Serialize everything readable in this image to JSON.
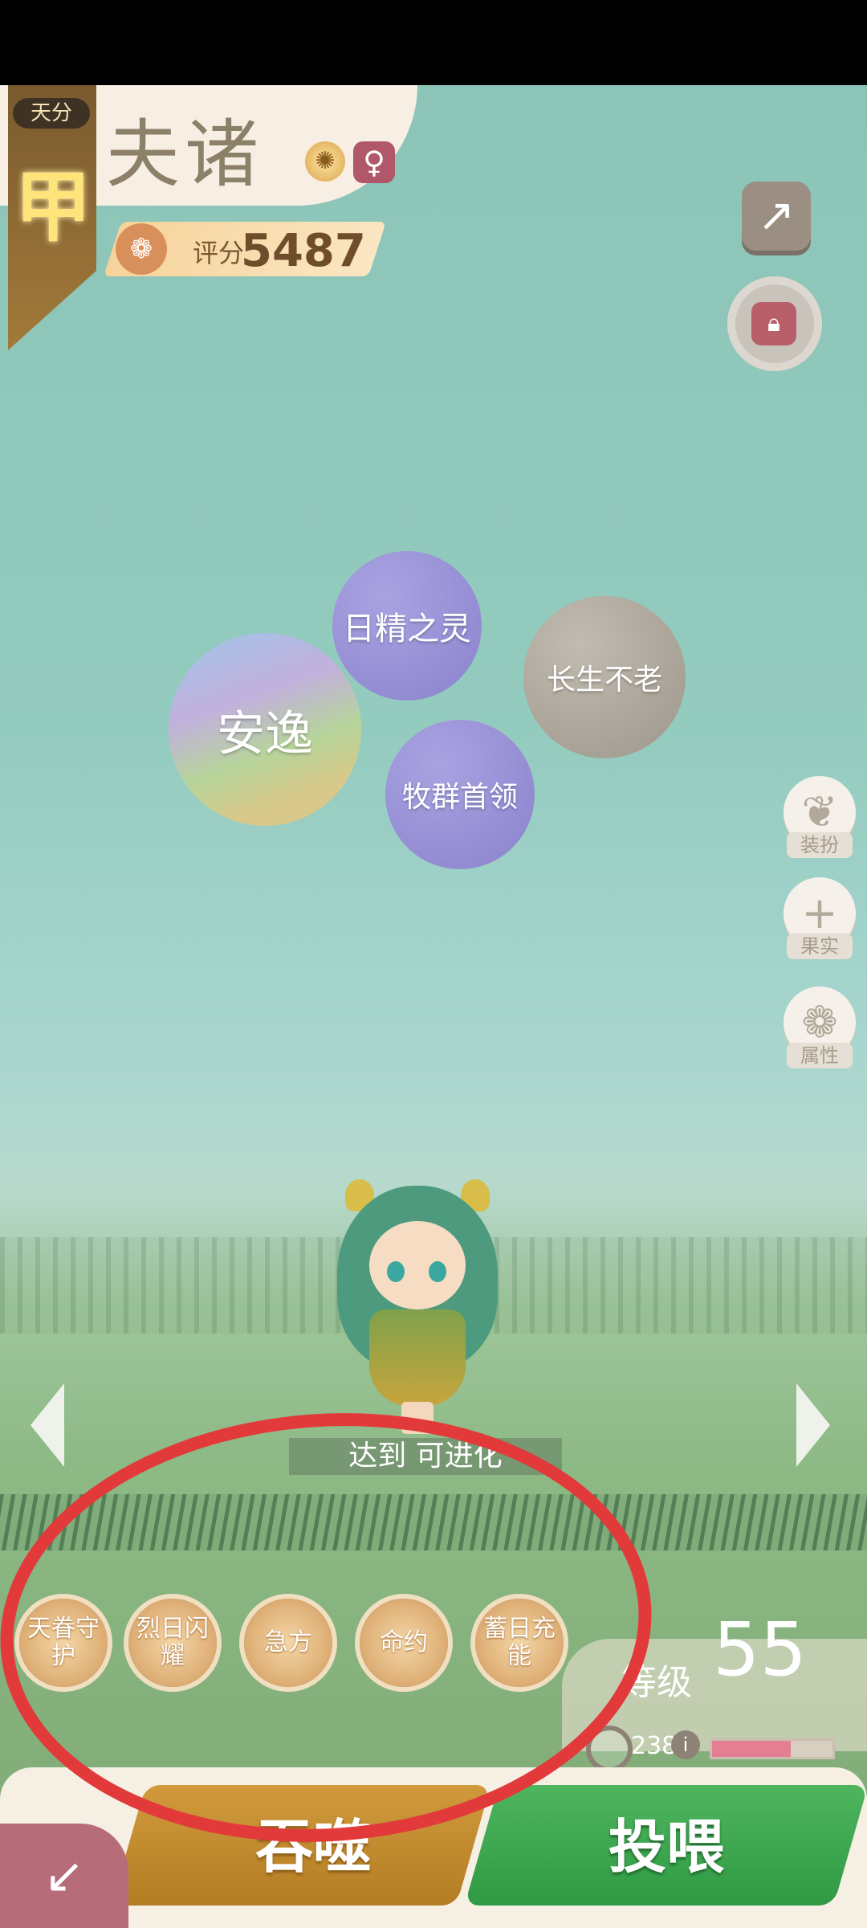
{
  "header": {
    "rank_label": "天分",
    "rank_value": "甲",
    "pet_name": "夫诸",
    "gender_symbol": "♀",
    "attribute_icon": "sun-icon",
    "score_label": "评分",
    "score_value": "5487"
  },
  "bubbles": [
    "日精之灵",
    "长生不老",
    "安逸",
    "牧群首领"
  ],
  "side_buttons": [
    {
      "label": "装扮",
      "icon": "butterfly-icon",
      "glyph": "❦"
    },
    {
      "label": "果实",
      "icon": "plus-icon",
      "glyph": "+"
    },
    {
      "label": "属性",
      "icon": "paw-icon",
      "glyph": "❁"
    }
  ],
  "evolve_tip": "达到 可进化",
  "skills": [
    "天眷守护",
    "烈日闪耀",
    "急方",
    "命约",
    "蓄日充能"
  ],
  "level": {
    "label": "等级",
    "value": "55",
    "exp_count": "238",
    "exp_fill_fraction": 0.65
  },
  "bottom": {
    "devour_label": "吞噬",
    "feed_label": "投喂"
  },
  "colors": {
    "feed_green": "#3aa84f",
    "devour_orange": "#c28a2f",
    "annotation_red": "#e23a3a"
  }
}
